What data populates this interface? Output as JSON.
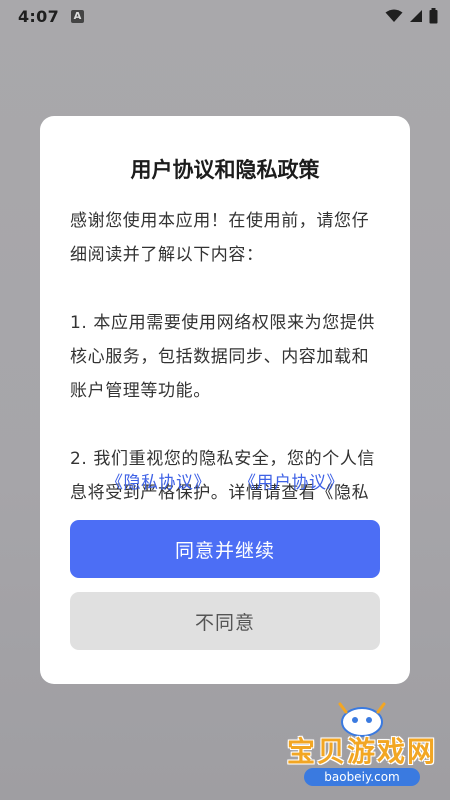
{
  "status_bar": {
    "time": "4:07",
    "notification_letter": "A",
    "icons": [
      "wifi-icon",
      "signal-icon",
      "battery-icon"
    ]
  },
  "dialog": {
    "title": "用户协议和隐私政策",
    "paragraphs": [
      "感谢您使用本应用！在使用前，请您仔细阅读并了解以下内容：",
      "1. 本应用需要使用网络权限来为您提供核心服务，包括数据同步、内容加载和账户管理等功能。",
      "2. 我们重视您的隐私安全，您的个人信息将受到严格保护。详情请查看《隐私"
    ],
    "links": {
      "privacy": "《隐私协议》",
      "user": "《用户协议》"
    },
    "buttons": {
      "agree": "同意并继续",
      "disagree": "不同意"
    }
  },
  "watermark": {
    "text": "宝贝游戏网",
    "url": "baobeiy.com"
  },
  "colors": {
    "accent": "#4c6ef5",
    "link": "#3f62e6",
    "disagree_bg": "#e0e0e0",
    "overlay_bg": "#a8a7aa"
  }
}
